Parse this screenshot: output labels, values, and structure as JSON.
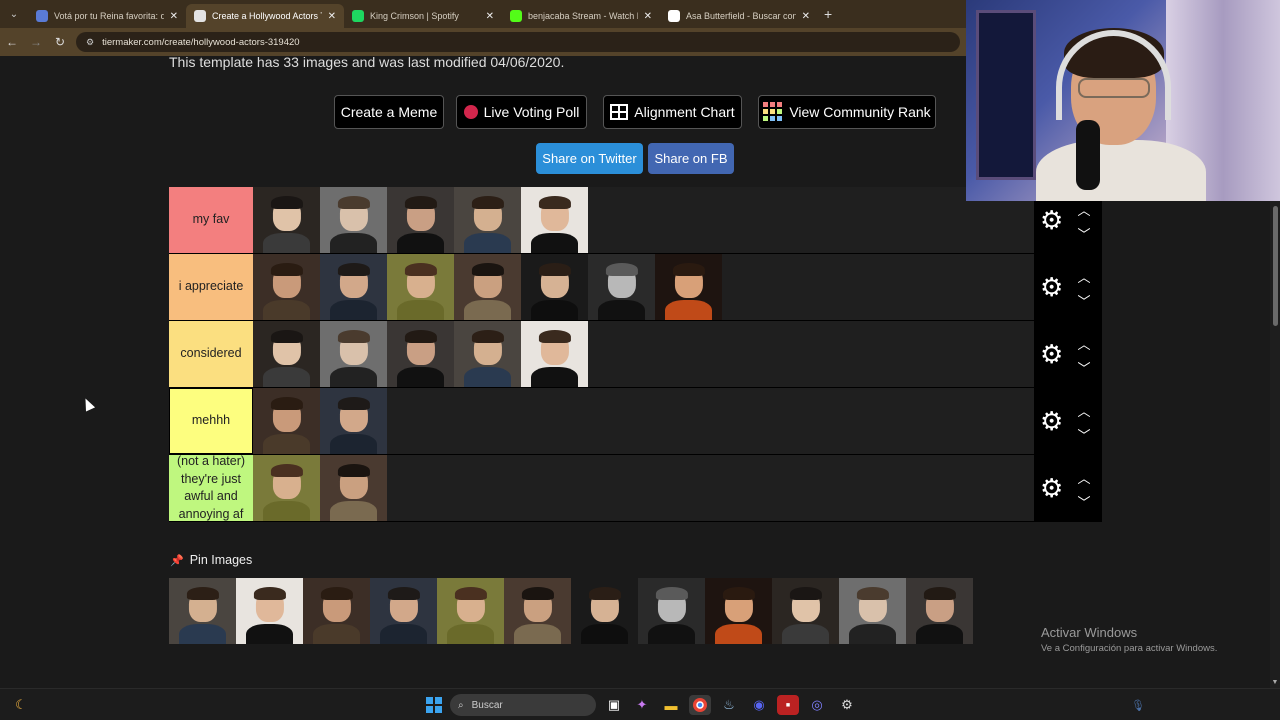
{
  "browser": {
    "tabs": [
      {
        "title": "Votá por tu Reina favorita: qué",
        "color": "#5a7bd6",
        "active": false
      },
      {
        "title": "Create a Hollywood Actors Tier",
        "color": "#e3e3e3",
        "active": true
      },
      {
        "title": "King Crimson | Spotify",
        "color": "#1ed760",
        "active": false
      },
      {
        "title": "benjacaba Stream - Watch Live",
        "color": "#53fc18",
        "active": false
      },
      {
        "title": "Asa Butterfield - Buscar con Go",
        "color": "#ffffff",
        "active": false
      }
    ],
    "new_tab": "+",
    "url": "tiermaker.com/create/hollywood-actors-319420"
  },
  "page": {
    "template_info": "This template has 33 images and was last modified 04/06/2020.",
    "buttons": {
      "meme": "Create a Meme",
      "poll": "Live Voting Poll",
      "alignment": "Alignment Chart",
      "community": "View Community Rank"
    },
    "share": {
      "twitter": "Share on Twitter",
      "fb": "Share on FB",
      "twitter_color": "#2b8fd9",
      "fb_color": "#4267b2"
    },
    "tiers": [
      {
        "label": "my fav",
        "color": "#f37f7f",
        "count": 5
      },
      {
        "label": "i appreciate",
        "color": "#f8be7e",
        "count": 7
      },
      {
        "label": "considered",
        "color": "#fbdf80",
        "count": 5
      },
      {
        "label": "mehhh",
        "color": "#fdfe7f",
        "count": 2
      },
      {
        "label": "(not a hater) they're just awful and annoying af",
        "color": "#bff77f",
        "count": 2
      }
    ],
    "pin_label": "Pin Images",
    "pool_count": 12
  },
  "watermark": {
    "line1": "Activar Windows",
    "line2": "Ve a Configuración para activar Windows."
  },
  "taskbar": {
    "search_placeholder": "Buscar"
  }
}
